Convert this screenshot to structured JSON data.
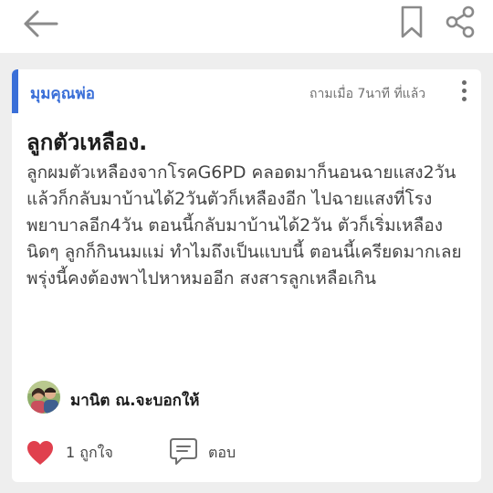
{
  "header": {
    "back_icon": "arrow-left-icon",
    "bookmark_icon": "bookmark-icon",
    "share_icon": "share-icon"
  },
  "post": {
    "category": "มุมคุณพ่อ",
    "timestamp": "ถามเมื่อ 7นาที ที่แล้ว",
    "title": "ลูกตัวเหลือง.",
    "body": "ลูกผมตัวเหลืองจากโรคG6PD คลอดมาก็นอนฉายแสง2วัน แล้วก็กลับมาบ้านได้2วันตัวก็เหลืองอีก ไปฉายแสงที่โรงพยาบาลอีก4วัน ตอนนี้กลับมาบ้านได้2วัน ตัวก็เริ่มเหลืองนิดๆ ลูกก็กินนมแม่ ทำไมถึงเป็นแบบนี้ ตอนนี้เครียดมากเลย พรุ่งนี้คงต้องพาไปหาหมออีก สงสารลูกเหลือเกิน",
    "author": "มานิต ณ.จะบอกให้",
    "like_label": "1 ถูกใจ",
    "reply_label": "ตอบ"
  },
  "colors": {
    "accent": "#3a6fd8",
    "heart": "#e0404e",
    "icon_gray": "#8a8a8a"
  }
}
